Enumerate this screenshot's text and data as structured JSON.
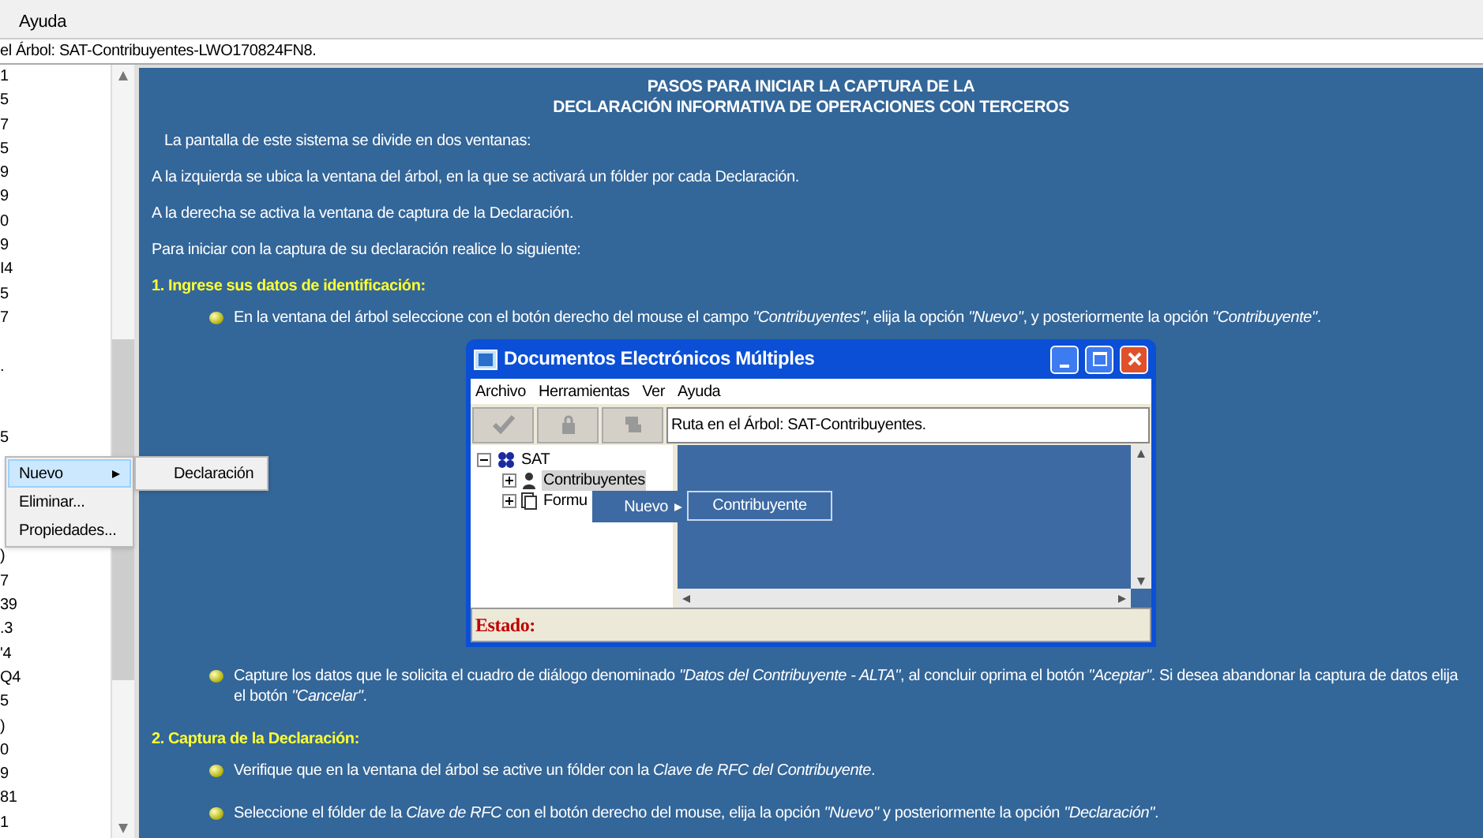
{
  "menu_bar": {
    "items": [
      "Ayuda"
    ]
  },
  "path_bar": {
    "text": "el Árbol: SAT-Contribuyentes-LWO170824FN8."
  },
  "tree_panel": {
    "upper_rows": [
      "1",
      "5",
      "7",
      "5",
      "9",
      "9",
      "0",
      "9",
      "I4",
      "5",
      "7",
      "",
      ".",
      "",
      "",
      "5"
    ],
    "lower_rows": [
      ")",
      "7",
      "39",
      ".3",
      "'4",
      "Q4",
      "5",
      ")",
      "0",
      "9",
      "81",
      "1"
    ]
  },
  "context_menu": {
    "items": [
      {
        "label": "Nuevo",
        "selected": true,
        "submenu": true
      },
      {
        "label": "Eliminar...",
        "selected": false,
        "submenu": false
      },
      {
        "label": "Propiedades...",
        "selected": false,
        "submenu": false
      }
    ],
    "submenu": [
      {
        "label": "Declaración",
        "selected": false
      }
    ]
  },
  "document": {
    "title": [
      "PASOS PARA INICIAR LA CAPTURA DE LA",
      "DECLARACIÓN INFORMATIVA DE OPERACIONES CON TERCEROS"
    ],
    "blocks": [
      {
        "kind": "intro",
        "text": "La pantalla de este sistema se divide en dos ventanas:"
      },
      {
        "kind": "paragraph",
        "text": "A la izquierda se ubica la ventana del árbol, en la que se activará un fólder por cada Declaración."
      },
      {
        "kind": "paragraph",
        "text": "A la derecha se activa la ventana de captura de la Declaración."
      },
      {
        "kind": "paragraph",
        "text": "Para iniciar con la captura de su declaración realice lo siguiente:"
      },
      {
        "kind": "heading",
        "text": "1. Ingrese sus datos de identificación:"
      },
      {
        "kind": "bullet",
        "text": "En la ventana del árbol seleccione con el botón derecho del mouse el campo *\"Contribuyentes\"*, elija la opción *\"Nuevo\"*, y posteriormente la opción *\"Contribuyente\"*."
      },
      {
        "kind": "figure"
      },
      {
        "kind": "bullet",
        "text": "Capture los datos que le solicita el cuadro de diálogo denominado *\"Datos del Contribuyente - ALTA\"*, al concluir oprima el botón *\"Aceptar\"*. Si desea abandonar la captura de datos elija el botón *\"Cancelar\"*."
      },
      {
        "kind": "heading",
        "text": "2. Captura de la Declaración:"
      },
      {
        "kind": "bullet",
        "text": "Verifique que en la ventana del árbol se active un fólder con la *Clave de RFC del Contribuyente*."
      },
      {
        "kind": "bullet",
        "text": "Seleccione el fólder de la *Clave de RFC* con el botón derecho del mouse, elija la opción *\"Nuevo\"* y posteriormente la opción *\"Declaración\"*."
      }
    ]
  },
  "figure": {
    "window_title": "Documentos Electrónicos Múltiples",
    "menu": [
      "Archivo",
      "Herramientas",
      "Ver",
      "Ayuda"
    ],
    "path": "Ruta en el Árbol: SAT-Contribuyentes.",
    "tree": [
      {
        "label": "SAT",
        "expanded": true,
        "children": [
          {
            "label": "Contribuyentes",
            "expanded": false,
            "selected": true
          },
          {
            "label": "Formu",
            "expanded": false,
            "selected": false
          }
        ]
      }
    ],
    "context_menu": [
      {
        "label": "Nuevo",
        "selected": true
      }
    ],
    "submenu": [
      {
        "label": "Contribuyente",
        "selected": true
      }
    ],
    "status_label": "Estado:"
  }
}
